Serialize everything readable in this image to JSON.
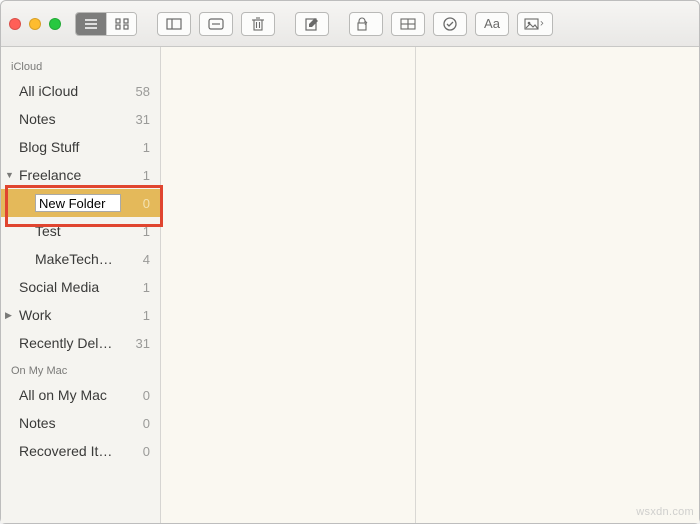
{
  "toolbar": {
    "format_icon": "Aa"
  },
  "sidebar": {
    "sections": [
      {
        "title": "iCloud",
        "items": [
          {
            "label": "All iCloud",
            "count": 58
          },
          {
            "label": "Notes",
            "count": 31
          },
          {
            "label": "Blog Stuff",
            "count": 1
          },
          {
            "label": "Freelance",
            "count": 1,
            "expanded": true
          },
          {
            "label": "New Folder",
            "count": 0,
            "selected": true,
            "editing": true
          },
          {
            "label": "Test",
            "count": 1
          },
          {
            "label": "MakeTech…",
            "count": 4
          },
          {
            "label": "Social Media",
            "count": 1
          },
          {
            "label": "Work",
            "count": 1,
            "expanded": false
          },
          {
            "label": "Recently Del…",
            "count": 31
          }
        ]
      },
      {
        "title": "On My Mac",
        "items": [
          {
            "label": "All on My Mac",
            "count": 0
          },
          {
            "label": "Notes",
            "count": 0
          },
          {
            "label": "Recovered It…",
            "count": 0
          }
        ]
      }
    ]
  },
  "colors": {
    "selection": "#e4b95a",
    "highlight_box": "#e0452f"
  },
  "watermark": "wsxdn.com"
}
